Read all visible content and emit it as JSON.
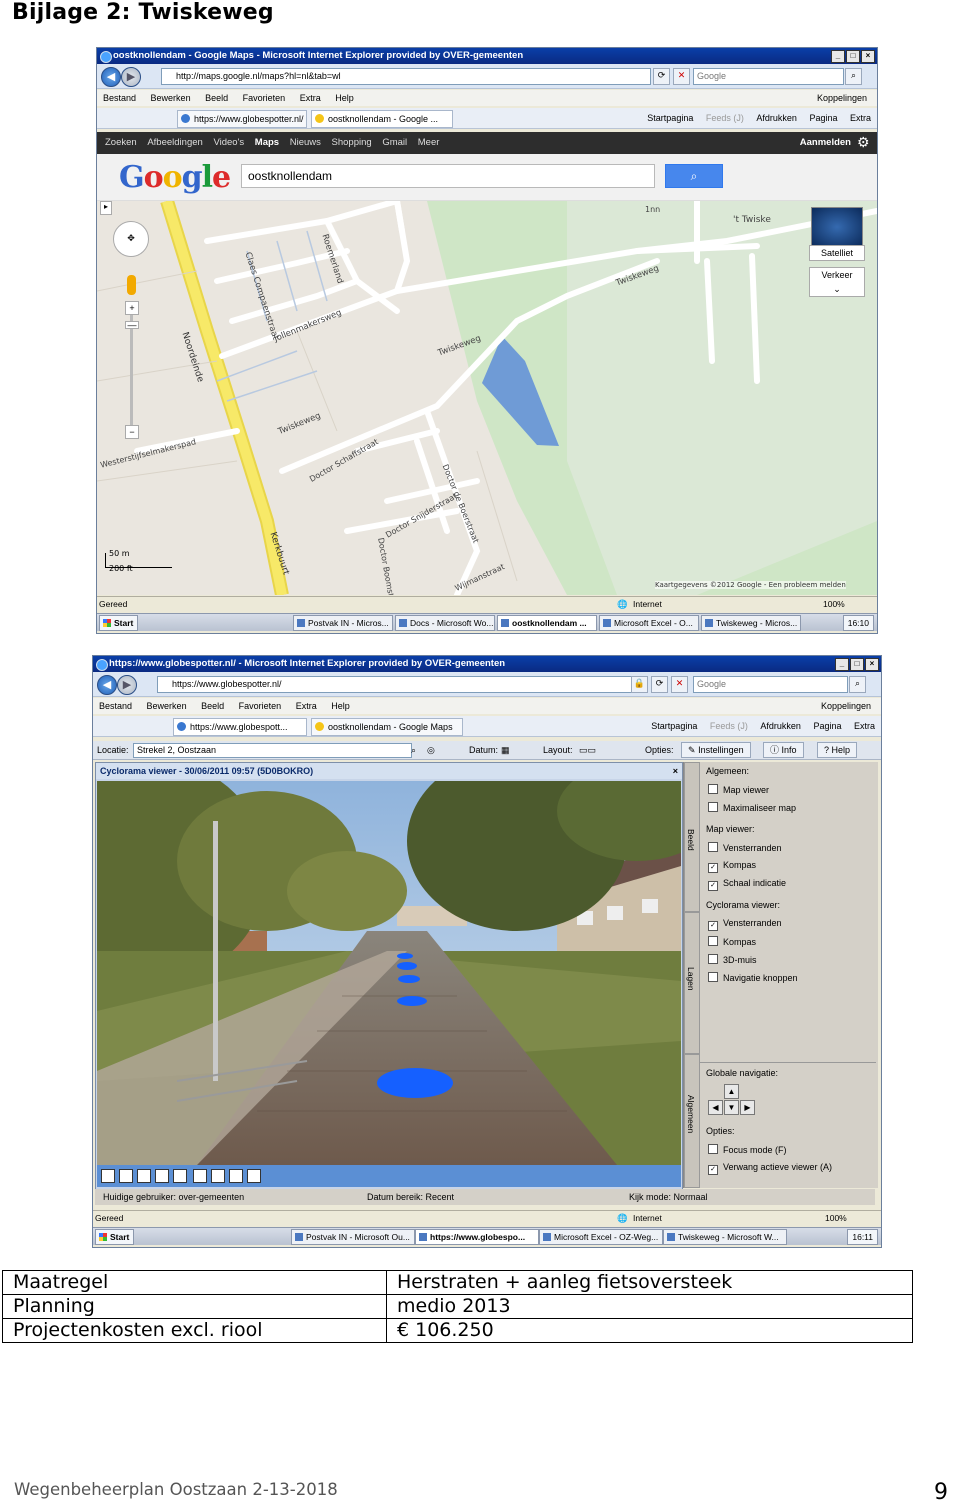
{
  "heading": "Bijlage 2: Twiskeweg",
  "screenshot1": {
    "window_title": "oostknollendam - Google Maps - Microsoft Internet Explorer provided by OVER-gemeenten",
    "address": "http://maps.google.nl/maps?hl=nl&tab=wl",
    "search_placeholder": "Google",
    "menu": [
      "Bestand",
      "Bewerken",
      "Beeld",
      "Favorieten",
      "Extra",
      "Help"
    ],
    "menu_right": "Koppelingen",
    "tabs": [
      "https://www.globespotter.nl/",
      "oostknollendam - Google ..."
    ],
    "toolbar_right": [
      "Startpagina",
      "Feeds (J)",
      "Afdrukken",
      "Pagina",
      "Extra"
    ],
    "google_nav": [
      "Zoeken",
      "Afbeeldingen",
      "Video's",
      "Maps",
      "Nieuws",
      "Shopping",
      "Gmail",
      "Meer"
    ],
    "google_nav_right": "Aanmelden",
    "logo": "Google",
    "query": "oostknollendam",
    "map_labels": {
      "noordeinde": "Noordeinde",
      "kerkbuurt": "Kerkbuurt",
      "twiskeweg_a": "Twiskeweg",
      "twiskeweg_b": "Twiskeweg",
      "twiskeweg_c": "Twiskeweg",
      "jollenmakerserf": "Jollenmakersweg",
      "claes": "Claes Compaenstraat",
      "roemeriand": "Roemerland",
      "westerstijfsel": "Westerstijfselmakerspad",
      "schaffstraat": "Doctor Schaffstraat",
      "snijderstraat": "Doctor Snijderstraat",
      "boerstraat": "Doctor de Boerstraat",
      "boomstraat": "Doctor Boomstr.",
      "wijmanstraat": "Wijmanstraat",
      "t_twiske": "'t Twiske",
      "nr_1nn": "1nn"
    },
    "map_buttons": {
      "satellite": "Satelliet",
      "traffic": "Verkeer"
    },
    "scale": {
      "metric": "50 m",
      "imperial": "200 ft"
    },
    "attribution": "Kaartgegevens ©2012 Google - Een probleem melden",
    "status_left": "Gereed",
    "status_zone": "Internet",
    "zoom": "100%",
    "taskbar": {
      "start": "Start",
      "items": [
        "Postvak IN - Micros...",
        "Docs - Microsoft Wo...",
        "oostknollendam ...",
        "Microsoft Excel - O...",
        "Twiskeweg - Micros..."
      ],
      "active_index": 2,
      "clock": "16:10"
    }
  },
  "screenshot2": {
    "window_title": "https://www.globespotter.nl/ - Microsoft Internet Explorer provided by OVER-gemeenten",
    "address": "https://www.globespotter.nl/",
    "search_placeholder": "Google",
    "menu": [
      "Bestand",
      "Bewerken",
      "Beeld",
      "Favorieten",
      "Extra",
      "Help"
    ],
    "menu_right": "Koppelingen",
    "tabs": [
      "https://www.globespott...",
      "oostknollendam - Google Maps"
    ],
    "toolbar_right": [
      "Startpagina",
      "Feeds (J)",
      "Afdrukken",
      "Pagina",
      "Extra"
    ],
    "location_label": "Locatie:",
    "location_value": "Strekel 2, Oostzaan",
    "datum_label": "Datum:",
    "layout_label": "Layout:",
    "options_label": "Opties:",
    "gs_buttons": [
      "Instellingen",
      "Info",
      "Help"
    ],
    "viewer_title": "Cyclorama viewer - 30/06/2011 09:57 (5D0BOKRO)",
    "side_tabs": [
      "Beeld",
      "Lagen",
      "Algemeen"
    ],
    "settings": {
      "algemeen": "Algemeen:",
      "algemeen_opts": [
        {
          "label": "Map viewer",
          "on": false
        },
        {
          "label": "Maximaliseer map",
          "on": false
        }
      ],
      "mapviewer": "Map viewer:",
      "mapviewer_opts": [
        {
          "label": "Vensterranden",
          "on": false
        },
        {
          "label": "Kompas",
          "on": true
        },
        {
          "label": "Schaal indicatie",
          "on": true
        }
      ],
      "cyclorama": "Cyclorama viewer:",
      "cyclorama_opts": [
        {
          "label": "Vensterranden",
          "on": true
        },
        {
          "label": "Kompas",
          "on": false
        },
        {
          "label": "3D-muis",
          "on": false
        },
        {
          "label": "Navigatie knoppen",
          "on": false
        }
      ],
      "globale": "Globale navigatie:",
      "opties": "Opties:",
      "opties_opts": [
        {
          "label": "Focus mode (F)",
          "on": false
        },
        {
          "label": "Verwang actieve viewer (A)",
          "on": true
        }
      ]
    },
    "footer_user": "Huidige gebruiker:  over-gemeenten",
    "footer_datum": "Datum bereik:  Recent",
    "footer_mode": "Kijk mode:  Normaal",
    "status_left": "Gereed",
    "status_zone": "Internet",
    "zoom": "100%",
    "taskbar": {
      "start": "Start",
      "items": [
        "Postvak IN - Microsoft Ou...",
        "https://www.globespo...",
        "Microsoft Excel - OZ-Weg...",
        "Twiskeweg - Microsoft W..."
      ],
      "active_index": 1,
      "clock": "16:11"
    }
  },
  "table": {
    "rows": [
      {
        "label": "Maatregel",
        "value": "Herstraten + aanleg fietsoversteek"
      },
      {
        "label": "Planning",
        "value": "medio 2013"
      },
      {
        "label": "Projectenkosten excl. riool",
        "value": "€ 106.250"
      }
    ]
  },
  "footer": "Wegenbeheerplan Oostzaan 2-13-2018",
  "page_number": "9",
  "colors": {
    "title_bar": "#0a3fa8",
    "map_road_yellow": "#f7e968",
    "water": "#6f9bd6",
    "marker_blue": "#1560ff"
  }
}
